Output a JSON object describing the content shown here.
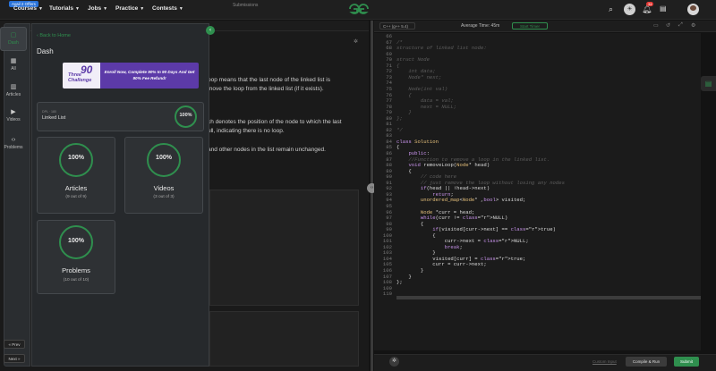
{
  "topnav": {
    "offer_badge": "Avail 2 Offers",
    "items": [
      "Courses",
      "Tutorials",
      "Jobs",
      "Practice",
      "Contests"
    ],
    "notification_count": "34",
    "colors": {
      "accent": "#2f8f4e",
      "background": "#131313"
    }
  },
  "problem": {
    "tab_submissions": "Submissions",
    "para1": "oop means that the last node of the linked list is",
    "para2": "move the loop from the linked list (if it exists).",
    "para3": "ch denotes the position of the node to which the last",
    "para4": "ull, indicating there is no loop.",
    "para5": "and other nodes in the list remain unchanged."
  },
  "editor": {
    "language": "C++ (g++ 5.4)",
    "average_time": "Average Time: 45m",
    "start_timer": "Start Timer",
    "custom_input": "Custom Input",
    "compile_run": "Compile & Run",
    "submit": "Submit",
    "code_lines": [
      {
        "n": "66",
        "t": ""
      },
      {
        "n": "67",
        "t": "/*"
      },
      {
        "n": "68",
        "t": "structure of linked list node:"
      },
      {
        "n": "69",
        "t": ""
      },
      {
        "n": "70",
        "t": "struct Node"
      },
      {
        "n": "71",
        "t": "{"
      },
      {
        "n": "72",
        "t": "    int data;"
      },
      {
        "n": "73",
        "t": "    Node* next;"
      },
      {
        "n": "74",
        "t": ""
      },
      {
        "n": "75",
        "t": "    Node(int val)"
      },
      {
        "n": "76",
        "t": "    {"
      },
      {
        "n": "77",
        "t": "        data = val;"
      },
      {
        "n": "78",
        "t": "        next = NULL;"
      },
      {
        "n": "79",
        "t": "    }"
      },
      {
        "n": "80",
        "t": "};"
      },
      {
        "n": "81",
        "t": ""
      },
      {
        "n": "82",
        "t": "*/"
      },
      {
        "n": "83",
        "t": ""
      },
      {
        "n": "84",
        "t": "class Solution"
      },
      {
        "n": "85",
        "t": "{"
      },
      {
        "n": "86",
        "t": "    public:"
      },
      {
        "n": "87",
        "t": "    //Function to remove a loop in the linked list."
      },
      {
        "n": "88",
        "t": "    void removeLoop(Node* head)"
      },
      {
        "n": "89",
        "t": "    {"
      },
      {
        "n": "90",
        "t": "        // code here"
      },
      {
        "n": "91",
        "t": "        // just remove the loop without losing any nodes"
      },
      {
        "n": "92",
        "t": "        if(head || !head->next)"
      },
      {
        "n": "93",
        "t": "            return;"
      },
      {
        "n": "94",
        "t": "        unordered_map<Node* ,bool> visited;"
      },
      {
        "n": "95",
        "t": ""
      },
      {
        "n": "96",
        "t": "        Node *curr = head;"
      },
      {
        "n": "97",
        "t": "        while(curr != NULL)"
      },
      {
        "n": "98",
        "t": "        {"
      },
      {
        "n": "99",
        "t": "            if(visited[curr->next] == true)"
      },
      {
        "n": "100",
        "t": "            {"
      },
      {
        "n": "101",
        "t": "                curr->next = NULL;"
      },
      {
        "n": "102",
        "t": "                break;"
      },
      {
        "n": "103",
        "t": "            }"
      },
      {
        "n": "104",
        "t": "            visited[curr] = true;"
      },
      {
        "n": "105",
        "t": "            curr = curr->next;"
      },
      {
        "n": "106",
        "t": "        }"
      },
      {
        "n": "107",
        "t": "    }"
      },
      {
        "n": "108",
        "t": "};"
      },
      {
        "n": "109",
        "t": ""
      },
      {
        "n": "110",
        "t": ""
      }
    ]
  },
  "rail": {
    "items": [
      {
        "label": "Dash",
        "icon": "dashboard-icon",
        "glyph": "▢"
      },
      {
        "label": "All",
        "icon": "grid-icon",
        "glyph": "▦"
      },
      {
        "label": "Articles",
        "icon": "book-icon",
        "glyph": "▥"
      },
      {
        "label": "Videos",
        "icon": "video-icon",
        "glyph": "▶"
      },
      {
        "label": "Problems",
        "icon": "code-icon",
        "glyph": "‹›"
      }
    ],
    "prev": "« Prev",
    "next": "Next »"
  },
  "drawer": {
    "back_home": "Back to Home",
    "title": "Dash",
    "banner_three": "Three",
    "banner_challenge": "Challenge",
    "banner_ninety": "90",
    "banner_text": "Enroll Now, Complete 90% In 90 Days And Get 90% Fee Refund!",
    "linked_list_meta": "DPL · 180",
    "linked_list_title": "Linked List",
    "linked_list_percent": "100%",
    "articles": {
      "percent": "100%",
      "title": "Articles",
      "sub": "(9 out of 9)"
    },
    "videos": {
      "percent": "100%",
      "title": "Videos",
      "sub": "(3 out of 3)"
    },
    "problems": {
      "percent": "100%",
      "title": "Problems",
      "sub": "(10 out of 10)"
    }
  }
}
